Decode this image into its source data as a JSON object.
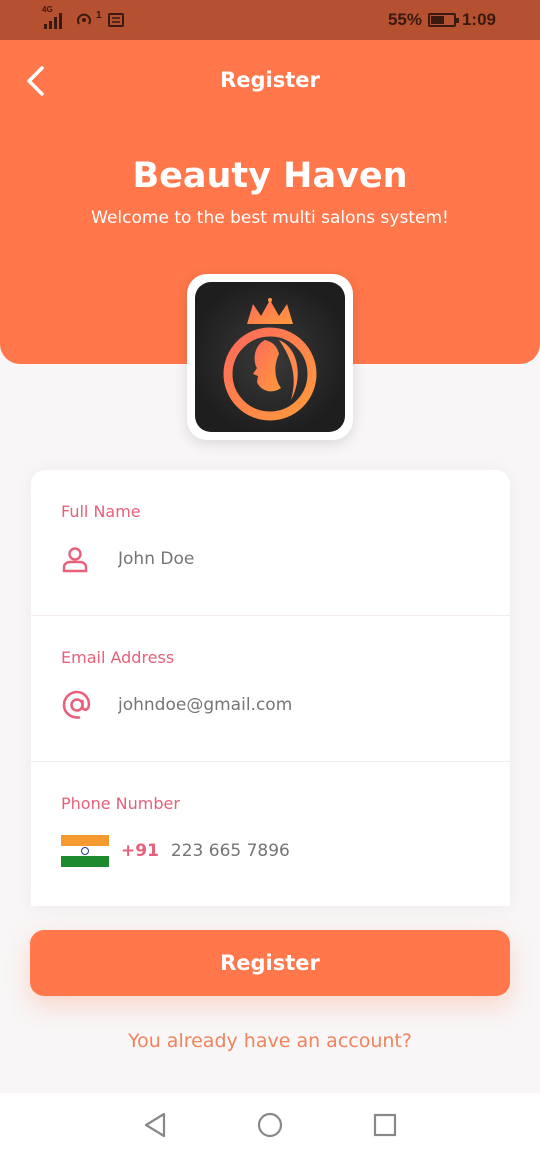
{
  "status_bar": {
    "network": "4G",
    "sim_index": "1",
    "battery": "55%",
    "time": "1:09"
  },
  "header": {
    "title": "Register",
    "brand": "Beauty Haven",
    "tagline": "Welcome to the best multi salons system!"
  },
  "form": {
    "full_name": {
      "label": "Full Name",
      "placeholder": "John Doe",
      "icon": "person-icon"
    },
    "email": {
      "label": "Email Address",
      "placeholder": "johndoe@gmail.com",
      "icon": "at-icon"
    },
    "phone": {
      "label": "Phone Number",
      "country_code": "+91",
      "placeholder": "223 665 7896",
      "flag": "india-flag-icon"
    }
  },
  "actions": {
    "register_label": "Register",
    "login_link": "You already have an account?"
  },
  "colors": {
    "accent": "#ff774a",
    "label_pink": "#e8607a",
    "status_bar": "#b55030"
  }
}
